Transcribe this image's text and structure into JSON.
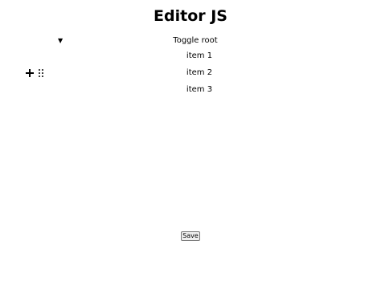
{
  "header": {
    "title": "Editor JS"
  },
  "editor": {
    "toggle": {
      "arrow_icon": "caret-down-icon",
      "label": "Toggle root"
    },
    "items": [
      {
        "label": "item 1"
      },
      {
        "label": "item 2"
      },
      {
        "label": "item 3"
      }
    ],
    "toolbar": {
      "plus_icon": "plus-icon",
      "drag_icon": "drag-handle-icon"
    }
  },
  "actions": {
    "save_label": "Save"
  }
}
